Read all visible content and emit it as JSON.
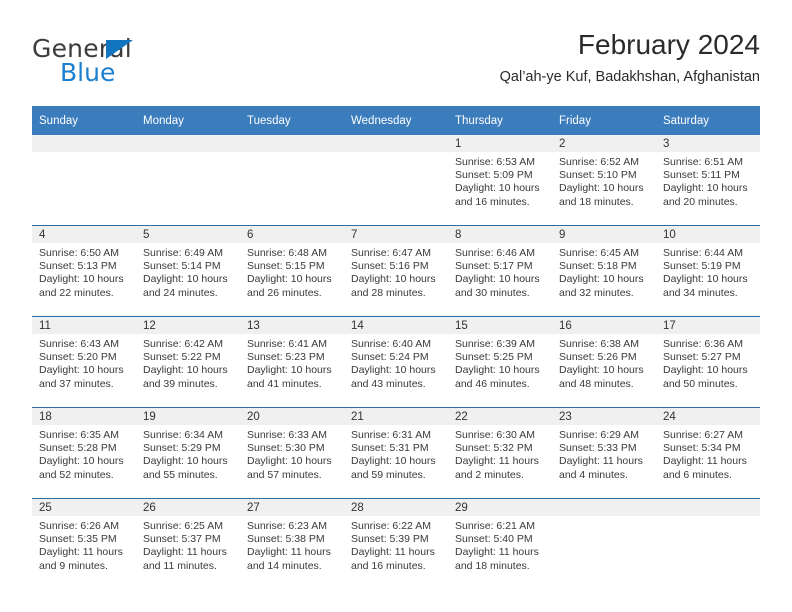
{
  "brand": {
    "name_part1": "General",
    "name_part2": "Blue",
    "accent_color": "#1a80cf",
    "triangle_color": "#1275c0"
  },
  "header": {
    "title": "February 2024",
    "location": "Qal’ah-ye Kuf, Badakhshan, Afghanistan"
  },
  "theme": {
    "header_row_bg": "#3b7cbd",
    "header_row_text": "#ffffff",
    "row_divider": "#2e6da8",
    "daynum_strip_bg": "#f0f0f0"
  },
  "weekdays": [
    "Sunday",
    "Monday",
    "Tuesday",
    "Wednesday",
    "Thursday",
    "Friday",
    "Saturday"
  ],
  "weeks": [
    [
      {
        "day": "",
        "sunrise": "",
        "sunset": "",
        "daylight1": "",
        "daylight2": ""
      },
      {
        "day": "",
        "sunrise": "",
        "sunset": "",
        "daylight1": "",
        "daylight2": ""
      },
      {
        "day": "",
        "sunrise": "",
        "sunset": "",
        "daylight1": "",
        "daylight2": ""
      },
      {
        "day": "",
        "sunrise": "",
        "sunset": "",
        "daylight1": "",
        "daylight2": ""
      },
      {
        "day": "1",
        "sunrise": "Sunrise: 6:53 AM",
        "sunset": "Sunset: 5:09 PM",
        "daylight1": "Daylight: 10 hours",
        "daylight2": "and 16 minutes."
      },
      {
        "day": "2",
        "sunrise": "Sunrise: 6:52 AM",
        "sunset": "Sunset: 5:10 PM",
        "daylight1": "Daylight: 10 hours",
        "daylight2": "and 18 minutes."
      },
      {
        "day": "3",
        "sunrise": "Sunrise: 6:51 AM",
        "sunset": "Sunset: 5:11 PM",
        "daylight1": "Daylight: 10 hours",
        "daylight2": "and 20 minutes."
      }
    ],
    [
      {
        "day": "4",
        "sunrise": "Sunrise: 6:50 AM",
        "sunset": "Sunset: 5:13 PM",
        "daylight1": "Daylight: 10 hours",
        "daylight2": "and 22 minutes."
      },
      {
        "day": "5",
        "sunrise": "Sunrise: 6:49 AM",
        "sunset": "Sunset: 5:14 PM",
        "daylight1": "Daylight: 10 hours",
        "daylight2": "and 24 minutes."
      },
      {
        "day": "6",
        "sunrise": "Sunrise: 6:48 AM",
        "sunset": "Sunset: 5:15 PM",
        "daylight1": "Daylight: 10 hours",
        "daylight2": "and 26 minutes."
      },
      {
        "day": "7",
        "sunrise": "Sunrise: 6:47 AM",
        "sunset": "Sunset: 5:16 PM",
        "daylight1": "Daylight: 10 hours",
        "daylight2": "and 28 minutes."
      },
      {
        "day": "8",
        "sunrise": "Sunrise: 6:46 AM",
        "sunset": "Sunset: 5:17 PM",
        "daylight1": "Daylight: 10 hours",
        "daylight2": "and 30 minutes."
      },
      {
        "day": "9",
        "sunrise": "Sunrise: 6:45 AM",
        "sunset": "Sunset: 5:18 PM",
        "daylight1": "Daylight: 10 hours",
        "daylight2": "and 32 minutes."
      },
      {
        "day": "10",
        "sunrise": "Sunrise: 6:44 AM",
        "sunset": "Sunset: 5:19 PM",
        "daylight1": "Daylight: 10 hours",
        "daylight2": "and 34 minutes."
      }
    ],
    [
      {
        "day": "11",
        "sunrise": "Sunrise: 6:43 AM",
        "sunset": "Sunset: 5:20 PM",
        "daylight1": "Daylight: 10 hours",
        "daylight2": "and 37 minutes."
      },
      {
        "day": "12",
        "sunrise": "Sunrise: 6:42 AM",
        "sunset": "Sunset: 5:22 PM",
        "daylight1": "Daylight: 10 hours",
        "daylight2": "and 39 minutes."
      },
      {
        "day": "13",
        "sunrise": "Sunrise: 6:41 AM",
        "sunset": "Sunset: 5:23 PM",
        "daylight1": "Daylight: 10 hours",
        "daylight2": "and 41 minutes."
      },
      {
        "day": "14",
        "sunrise": "Sunrise: 6:40 AM",
        "sunset": "Sunset: 5:24 PM",
        "daylight1": "Daylight: 10 hours",
        "daylight2": "and 43 minutes."
      },
      {
        "day": "15",
        "sunrise": "Sunrise: 6:39 AM",
        "sunset": "Sunset: 5:25 PM",
        "daylight1": "Daylight: 10 hours",
        "daylight2": "and 46 minutes."
      },
      {
        "day": "16",
        "sunrise": "Sunrise: 6:38 AM",
        "sunset": "Sunset: 5:26 PM",
        "daylight1": "Daylight: 10 hours",
        "daylight2": "and 48 minutes."
      },
      {
        "day": "17",
        "sunrise": "Sunrise: 6:36 AM",
        "sunset": "Sunset: 5:27 PM",
        "daylight1": "Daylight: 10 hours",
        "daylight2": "and 50 minutes."
      }
    ],
    [
      {
        "day": "18",
        "sunrise": "Sunrise: 6:35 AM",
        "sunset": "Sunset: 5:28 PM",
        "daylight1": "Daylight: 10 hours",
        "daylight2": "and 52 minutes."
      },
      {
        "day": "19",
        "sunrise": "Sunrise: 6:34 AM",
        "sunset": "Sunset: 5:29 PM",
        "daylight1": "Daylight: 10 hours",
        "daylight2": "and 55 minutes."
      },
      {
        "day": "20",
        "sunrise": "Sunrise: 6:33 AM",
        "sunset": "Sunset: 5:30 PM",
        "daylight1": "Daylight: 10 hours",
        "daylight2": "and 57 minutes."
      },
      {
        "day": "21",
        "sunrise": "Sunrise: 6:31 AM",
        "sunset": "Sunset: 5:31 PM",
        "daylight1": "Daylight: 10 hours",
        "daylight2": "and 59 minutes."
      },
      {
        "day": "22",
        "sunrise": "Sunrise: 6:30 AM",
        "sunset": "Sunset: 5:32 PM",
        "daylight1": "Daylight: 11 hours",
        "daylight2": "and 2 minutes."
      },
      {
        "day": "23",
        "sunrise": "Sunrise: 6:29 AM",
        "sunset": "Sunset: 5:33 PM",
        "daylight1": "Daylight: 11 hours",
        "daylight2": "and 4 minutes."
      },
      {
        "day": "24",
        "sunrise": "Sunrise: 6:27 AM",
        "sunset": "Sunset: 5:34 PM",
        "daylight1": "Daylight: 11 hours",
        "daylight2": "and 6 minutes."
      }
    ],
    [
      {
        "day": "25",
        "sunrise": "Sunrise: 6:26 AM",
        "sunset": "Sunset: 5:35 PM",
        "daylight1": "Daylight: 11 hours",
        "daylight2": "and 9 minutes."
      },
      {
        "day": "26",
        "sunrise": "Sunrise: 6:25 AM",
        "sunset": "Sunset: 5:37 PM",
        "daylight1": "Daylight: 11 hours",
        "daylight2": "and 11 minutes."
      },
      {
        "day": "27",
        "sunrise": "Sunrise: 6:23 AM",
        "sunset": "Sunset: 5:38 PM",
        "daylight1": "Daylight: 11 hours",
        "daylight2": "and 14 minutes."
      },
      {
        "day": "28",
        "sunrise": "Sunrise: 6:22 AM",
        "sunset": "Sunset: 5:39 PM",
        "daylight1": "Daylight: 11 hours",
        "daylight2": "and 16 minutes."
      },
      {
        "day": "29",
        "sunrise": "Sunrise: 6:21 AM",
        "sunset": "Sunset: 5:40 PM",
        "daylight1": "Daylight: 11 hours",
        "daylight2": "and 18 minutes."
      },
      {
        "day": "",
        "sunrise": "",
        "sunset": "",
        "daylight1": "",
        "daylight2": ""
      },
      {
        "day": "",
        "sunrise": "",
        "sunset": "",
        "daylight1": "",
        "daylight2": ""
      }
    ]
  ]
}
